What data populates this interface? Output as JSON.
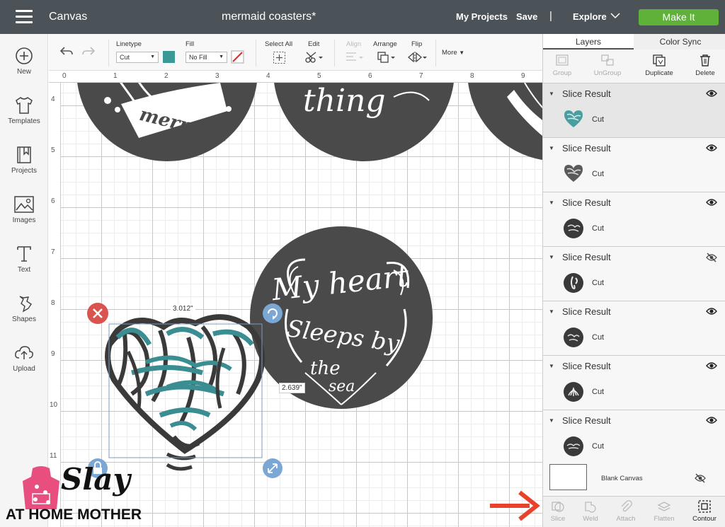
{
  "header": {
    "app_title": "Canvas",
    "project_title": "mermaid coasters*",
    "my_projects": "My Projects",
    "save": "Save",
    "separator": "|",
    "explore": "Explore",
    "make_it": "Make It"
  },
  "sidebar": {
    "items": [
      {
        "label": "New",
        "icon": "plus-circle-icon"
      },
      {
        "label": "Templates",
        "icon": "shirt-icon"
      },
      {
        "label": "Projects",
        "icon": "bookmark-icon"
      },
      {
        "label": "Images",
        "icon": "image-icon"
      },
      {
        "label": "Text",
        "icon": "text-icon"
      },
      {
        "label": "Shapes",
        "icon": "shapes-icon"
      },
      {
        "label": "Upload",
        "icon": "upload-icon"
      }
    ]
  },
  "toolbar": {
    "linetype_label": "Linetype",
    "linetype_value": "Cut",
    "fill_label": "Fill",
    "fill_value": "No Fill",
    "select_all_label": "Select All",
    "edit_label": "Edit",
    "align_label": "Align",
    "arrange_label": "Arrange",
    "flip_label": "Flip",
    "more_label": "More",
    "linetype_color": "#3a9896"
  },
  "ruler": {
    "top": [
      "0",
      "1",
      "2",
      "3",
      "4",
      "5",
      "6",
      "7",
      "8",
      "9"
    ],
    "left": [
      "4",
      "5",
      "6",
      "7",
      "8",
      "9",
      "10",
      "11"
    ]
  },
  "canvas": {
    "width_label": "3.012\"",
    "height_label": "2.639\"",
    "coaster_texts": [
      "mermaid",
      "thing",
      "My heart",
      "Sleeps by",
      "the",
      "sea"
    ]
  },
  "right_panel": {
    "tabs": [
      "Layers",
      "Color Sync"
    ],
    "actions": [
      {
        "label": "Group",
        "enabled": false,
        "icon": "group-icon"
      },
      {
        "label": "UnGroup",
        "enabled": false,
        "icon": "ungroup-icon"
      },
      {
        "label": "Duplicate",
        "enabled": true,
        "icon": "duplicate-icon"
      },
      {
        "label": "Delete",
        "enabled": true,
        "icon": "trash-icon"
      }
    ],
    "layers": [
      {
        "title": "Slice Result",
        "type": "Cut",
        "visible": true
      },
      {
        "title": "Slice Result",
        "type": "Cut",
        "visible": true
      },
      {
        "title": "Slice Result",
        "type": "Cut",
        "visible": true
      },
      {
        "title": "Slice Result",
        "type": "Cut",
        "visible": false
      },
      {
        "title": "Slice Result",
        "type": "Cut",
        "visible": true
      },
      {
        "title": "Slice Result",
        "type": "Cut",
        "visible": true
      },
      {
        "title": "Slice Result",
        "type": "Cut",
        "visible": true
      }
    ],
    "blank_canvas": "Blank Canvas",
    "bottom_actions": [
      {
        "label": "Slice",
        "enabled": false
      },
      {
        "label": "Weld",
        "enabled": false
      },
      {
        "label": "Attach",
        "enabled": false
      },
      {
        "label": "Flatten",
        "enabled": false
      },
      {
        "label": "Contour",
        "enabled": true
      }
    ]
  },
  "branding": {
    "slay": "Slay",
    "tagline": "AT HOME MOTHER"
  },
  "colors": {
    "header_bg": "#4c5358",
    "make_it_green": "#5fb13a",
    "coaster_dark": "#4a4a4a",
    "teal": "#3a8e92",
    "arrow_red": "#e8432a",
    "delete_red": "#d9534f",
    "handle_blue": "#7ba7d4"
  }
}
